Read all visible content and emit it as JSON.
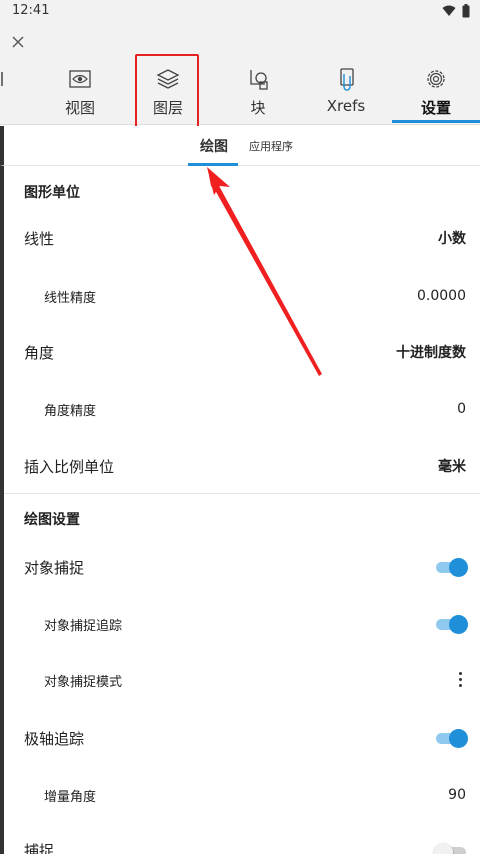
{
  "status": {
    "time": "12:41"
  },
  "tabs": [
    {
      "label": "综",
      "icon": "partial-icon"
    },
    {
      "label": "视图",
      "icon": "eye-icon"
    },
    {
      "label": "图层",
      "icon": "layers-icon"
    },
    {
      "label": "块",
      "icon": "block-icon"
    },
    {
      "label": "Xrefs",
      "icon": "xref-icon"
    },
    {
      "label": "设置",
      "icon": "gear-icon"
    }
  ],
  "subtabs": {
    "drawing": "绘图",
    "app": "应用程序"
  },
  "sections": {
    "units": "图形单位",
    "drawing_settings": "绘图设置"
  },
  "rows": {
    "linear": {
      "label": "线性",
      "value": "小数"
    },
    "linear_precision": {
      "label": "线性精度",
      "value": "0.0000"
    },
    "angle": {
      "label": "角度",
      "value": "十进制度数"
    },
    "angle_precision": {
      "label": "角度精度",
      "value": "0"
    },
    "insert_unit": {
      "label": "插入比例单位",
      "value": "毫米"
    },
    "osnap": {
      "label": "对象捕捉",
      "on": true
    },
    "osnap_track": {
      "label": "对象捕捉追踪",
      "on": true
    },
    "osnap_mode": {
      "label": "对象捕捉模式"
    },
    "polar": {
      "label": "极轴追踪",
      "on": true
    },
    "increment": {
      "label": "增量角度",
      "value": "90"
    },
    "snap": {
      "label": "捕捉",
      "on": false
    }
  },
  "colors": {
    "accent": "#1e8fd8",
    "highlight": "#e52020"
  }
}
